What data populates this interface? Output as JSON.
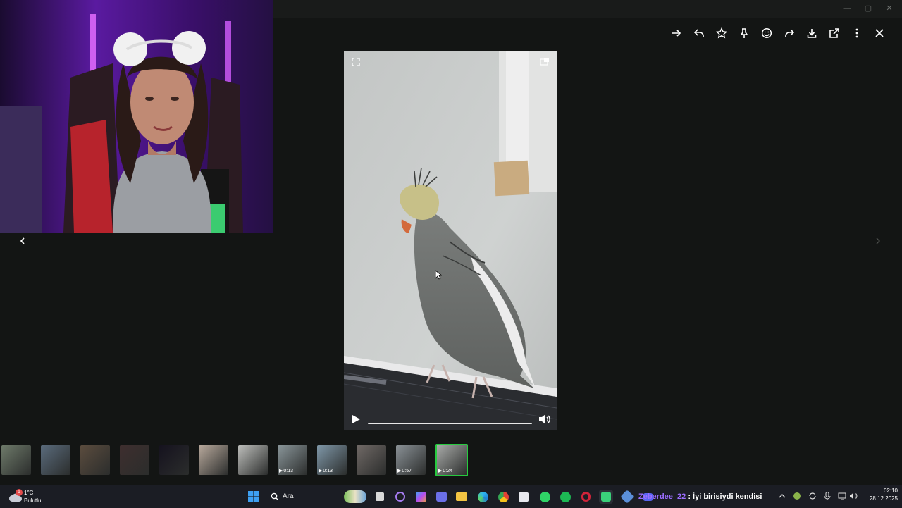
{
  "viewer": {
    "toolbar": [
      {
        "name": "forward-icon",
        "title": "Forward"
      },
      {
        "name": "reply-icon",
        "title": "Reply"
      },
      {
        "name": "star-icon",
        "title": "Star"
      },
      {
        "name": "pin-icon",
        "title": "Pin"
      },
      {
        "name": "emoji-icon",
        "title": "React"
      },
      {
        "name": "share-icon",
        "title": "Share"
      },
      {
        "name": "download-icon",
        "title": "Download"
      },
      {
        "name": "open-external-icon",
        "title": "Open"
      },
      {
        "name": "more-icon",
        "title": "More"
      },
      {
        "name": "close-icon",
        "title": "Close"
      }
    ],
    "video": {
      "progress": 0.0,
      "playing": false
    },
    "thumbnails": [
      {
        "duration": "",
        "color": "#6e7a6a"
      },
      {
        "duration": "",
        "color": "#5a6b7c"
      },
      {
        "duration": "",
        "color": "#5b4c3e"
      },
      {
        "duration": "",
        "color": "#3e2e2e"
      },
      {
        "duration": "",
        "color": "#15121e"
      },
      {
        "duration": "",
        "color": "#b8a99c"
      },
      {
        "duration": "",
        "color": "#bdbebb"
      },
      {
        "duration": "0:13",
        "color": "#8a969a"
      },
      {
        "duration": "0:13",
        "color": "#7f97a8"
      },
      {
        "duration": "",
        "color": "#706966"
      },
      {
        "duration": "0:57",
        "color": "#8a9196"
      },
      {
        "duration": "0:24",
        "color": "#a8aaa8"
      }
    ]
  },
  "taskbar": {
    "weather": {
      "temp": "1°C",
      "condition": "Bulutlu",
      "badge": "5"
    },
    "search_label": "Ara",
    "chat_overlay": {
      "user": "Zeberdee_22",
      "message": " : İyi birisiydi kendisi"
    },
    "clock": {
      "time": "02:10",
      "date": "28.12.2025"
    }
  },
  "colors": {
    "accent": "#27c93f",
    "chat_user": "#9b6dff"
  }
}
